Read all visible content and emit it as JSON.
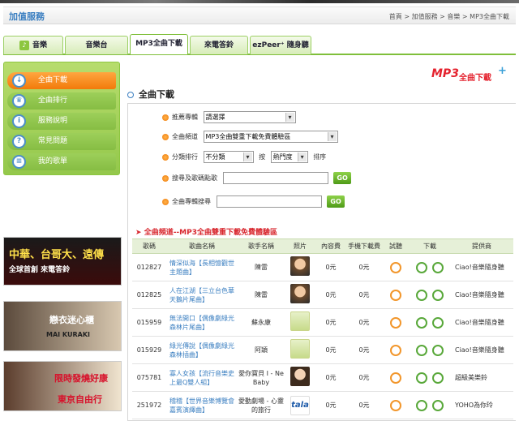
{
  "header": {
    "title": "加值服務",
    "breadcrumb": [
      "首頁",
      "加值服務",
      "音樂",
      "MP3全曲下載"
    ]
  },
  "tabs": [
    {
      "label": "音樂",
      "active": false,
      "icon": "music-icon"
    },
    {
      "label": "音樂台",
      "active": false
    },
    {
      "label": "MP3全曲下載",
      "active": true
    },
    {
      "label": "來電答鈴",
      "active": false
    },
    {
      "label": "ezPeer⁺ 隨身聽",
      "active": false
    }
  ],
  "sidebar": {
    "items": [
      {
        "label": "全曲下載",
        "active": true,
        "icon": "download-icon"
      },
      {
        "label": "全曲排行",
        "active": false,
        "icon": "crown-icon"
      },
      {
        "label": "服務說明",
        "active": false,
        "icon": "info-icon"
      },
      {
        "label": "常見問題",
        "active": false,
        "icon": "question-icon"
      },
      {
        "label": "我的歌單",
        "active": false,
        "icon": "list-icon"
      }
    ]
  },
  "ads": [
    {
      "lines": [
        "中華、台哥大、遠傳",
        "全球首創 來電答鈴"
      ]
    },
    {
      "lines": [
        "戀衣迷心櫃",
        "MAI KURAKI"
      ]
    },
    {
      "lines": [
        "限時發燒好康",
        "東京自由行"
      ]
    }
  ],
  "logo": {
    "mp3": "MP3",
    "text": "全曲下載",
    "plus": "+"
  },
  "section_title": "全曲下載",
  "search": {
    "category_label": "推薦專輯",
    "category_value": "請選擇",
    "channel_label": "全曲頻道",
    "channel_value": "MP3全曲雙重下載免費體驗區",
    "sort_label": "分類排行",
    "sort_value1": "不分類",
    "sort_by": "按",
    "sort_value2": "熱門度",
    "sort_suffix": "排序",
    "keyword_label": "搜尋及歌碼點歌",
    "keyword_placeholder": "",
    "album_label": "全曲專輯搜尋",
    "album_placeholder": "",
    "go_label": "GO"
  },
  "channel_heading": "全曲頻道--MP3全曲雙重下載免費體驗區",
  "table": {
    "headers": [
      "歌碼",
      "歌曲名稱",
      "歌手名稱",
      "照片",
      "內容費",
      "手機下載費",
      "試聽",
      "下載",
      "提供商"
    ],
    "rows": [
      {
        "code": "012827",
        "song": "情深似海【長相憶觀世主題曲】",
        "artist": "陳雷",
        "photo": "singer-photo",
        "fee": "0元",
        "mobile_fee": "0元",
        "provider": "Ciao!音樂隨身聽"
      },
      {
        "code": "012825",
        "song": "人在江湖【三立台色華天鵝片尾曲】",
        "artist": "陳雷",
        "photo": "singer-photo",
        "fee": "0元",
        "mobile_fee": "0元",
        "provider": "Ciao!音樂隨身聽"
      },
      {
        "code": "015959",
        "song": "無法開口【偶像劇綠光森林片尾曲】",
        "artist": "蘇永康",
        "photo": "album-cover",
        "fee": "0元",
        "mobile_fee": "0元",
        "provider": "Ciao!音樂隨身聽"
      },
      {
        "code": "015929",
        "song": "綠光傳說【偶像劇綠光森林插曲】",
        "artist": "阿穎",
        "photo": "album-cover",
        "fee": "0元",
        "mobile_fee": "0元",
        "provider": "Ciao!音樂隨身聽"
      },
      {
        "code": "075781",
        "song": "寡人女孩【流行音樂史上最Q雙人組】",
        "artist": "愛你寶貝 I - Ne Baby",
        "photo": "singer-photo",
        "fee": "0元",
        "mobile_fee": "0元",
        "provider": "超級美樂鈴"
      },
      {
        "code": "251972",
        "song": "稽稽【世界音樂博覽會嘉賓演繹曲】",
        "artist": "愛動劇場 - 心靈的旅行",
        "photo": "tala-cover",
        "fee": "0元",
        "mobile_fee": "0元",
        "provider": "YOHO為你玲"
      }
    ]
  }
}
